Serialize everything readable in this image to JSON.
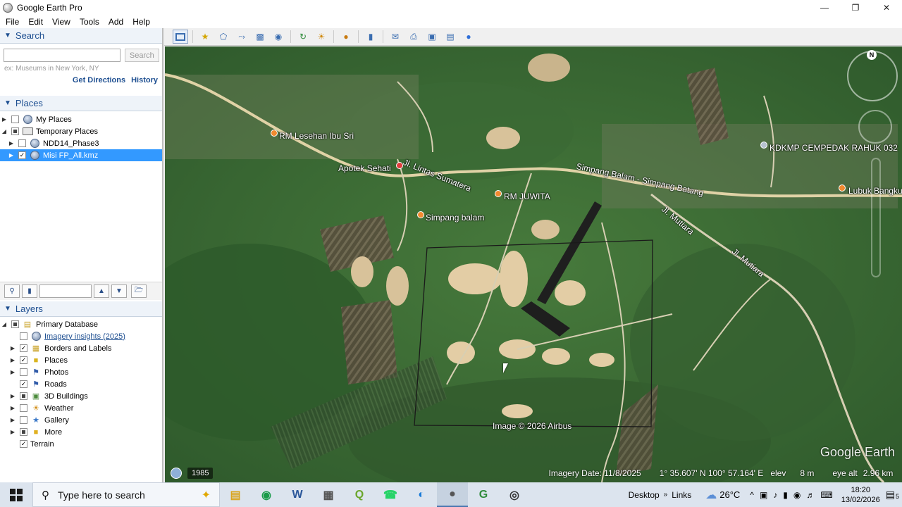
{
  "window": {
    "title": "Google Earth Pro",
    "controls": [
      "—",
      "❐",
      "✕"
    ]
  },
  "menu": [
    "File",
    "Edit",
    "View",
    "Tools",
    "Add",
    "Help"
  ],
  "search": {
    "header": "Search",
    "placeholder": "",
    "button": "Search",
    "hint": "ex: Museums in New York, NY",
    "get_directions": "Get Directions",
    "history": "History"
  },
  "places": {
    "header": "Places",
    "items": [
      {
        "label": "My Places",
        "expander": "▶",
        "checked": false
      },
      {
        "label": "Temporary Places",
        "expander": "◢",
        "checked": "partial"
      },
      {
        "label": "NDD14_Phase3",
        "expander": "▶",
        "checked": false
      },
      {
        "label": "Misi FP_All.kmz",
        "expander": "▶",
        "checked": true,
        "selected": true
      }
    ]
  },
  "layers": {
    "header": "Layers",
    "items": [
      {
        "label": "Primary Database",
        "expander": "◢",
        "checked": "partial"
      },
      {
        "label": "Imagery insights (2025)",
        "expander": "",
        "checked": false,
        "link": true
      },
      {
        "label": "Borders and Labels",
        "expander": "▶",
        "checked": true
      },
      {
        "label": "Places",
        "expander": "▶",
        "checked": true
      },
      {
        "label": "Photos",
        "expander": "▶",
        "checked": false
      },
      {
        "label": "Roads",
        "expander": "",
        "checked": true
      },
      {
        "label": "3D Buildings",
        "expander": "▶",
        "checked": "partial"
      },
      {
        "label": "Weather",
        "expander": "▶",
        "checked": false
      },
      {
        "label": "Gallery",
        "expander": "▶",
        "checked": false
      },
      {
        "label": "More",
        "expander": "▶",
        "checked": "partial"
      },
      {
        "label": "Terrain",
        "expander": "",
        "checked": true
      }
    ]
  },
  "map": {
    "labels": [
      {
        "text": "RM Lesehan Ibu Sri"
      },
      {
        "text": "Apotek Sehati"
      },
      {
        "text": "Jl. Lintas Sumatera"
      },
      {
        "text": "RM JUWITA"
      },
      {
        "text": "Simpang balam"
      },
      {
        "text": "Simpang Balam - Simpang Batang"
      },
      {
        "text": "Jl. Mutiara"
      },
      {
        "text": "Jl. Mutiara"
      },
      {
        "text": "KDKMP CEMPEDAK RAHUK 032"
      },
      {
        "text": "Lubuk Bangku"
      }
    ],
    "image_credit": "Image © 2026 Airbus",
    "logo": "Google Earth",
    "compass_north": "N",
    "poi_color": "#f28a30"
  },
  "status": {
    "historical_year": "1985",
    "imagery_date": "Imagery Date: 11/8/2025",
    "coords": "1° 35.607' N  100° 57.164' E",
    "elev_label": "elev",
    "elev_value": "8 m",
    "eye_alt_label": "eye alt",
    "eye_alt_value": "2.96 km"
  },
  "taskbar": {
    "search_placeholder": "Type here to search",
    "desktop": "Desktop",
    "links": "Links",
    "temperature": "26°C",
    "time": "18:20",
    "date": "13/02/2026",
    "notifications": "5"
  }
}
